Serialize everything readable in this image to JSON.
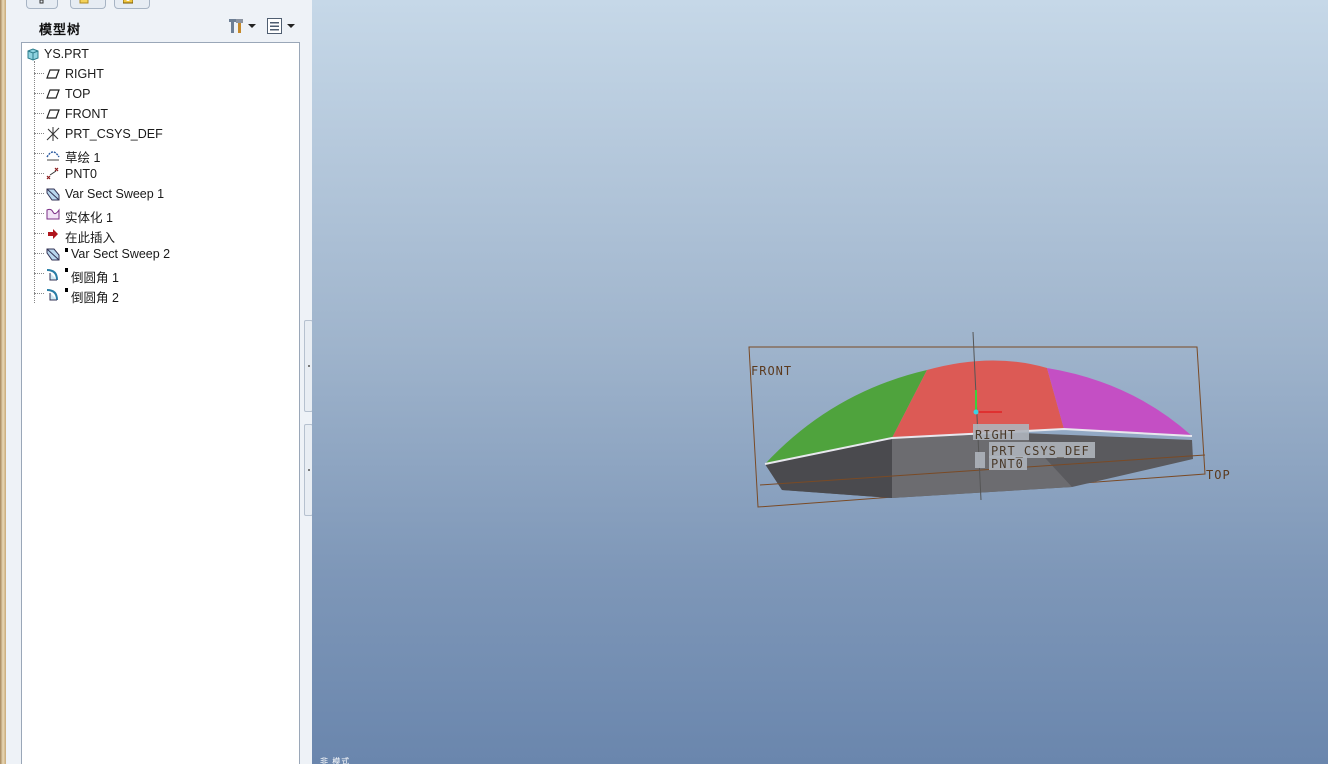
{
  "tree_panel": {
    "title": "模型树",
    "root": "YS.PRT",
    "items": [
      {
        "label": "RIGHT",
        "icon": "datum-plane-icon"
      },
      {
        "label": "TOP",
        "icon": "datum-plane-icon"
      },
      {
        "label": "FRONT",
        "icon": "datum-plane-icon"
      },
      {
        "label": "PRT_CSYS_DEF",
        "icon": "coordinate-system-icon"
      },
      {
        "label": "草绘 1",
        "icon": "sketch-icon"
      },
      {
        "label": "PNT0",
        "icon": "datum-point-icon"
      },
      {
        "label": "Var Sect Sweep 1",
        "icon": "sweep-icon"
      },
      {
        "label": "实体化 1",
        "icon": "solidify-icon"
      },
      {
        "label": "在此插入",
        "icon": "insert-here-arrow-icon"
      },
      {
        "label": "Var Sect Sweep 2",
        "icon": "sweep-icon"
      },
      {
        "label": "倒圆角 1",
        "icon": "round-icon"
      },
      {
        "label": "倒圆角 2",
        "icon": "round-icon"
      }
    ]
  },
  "viewport": {
    "datum_labels": {
      "front": "FRONT",
      "right": "RIGHT",
      "top": "TOP",
      "csys": "PRT_CSYS_DEF",
      "point": "PNT0"
    },
    "mode_text": "非  模式",
    "colors": {
      "bg_top": "#c6d8e8",
      "bg_bottom": "#6a86ad",
      "datum": "#7a4a25",
      "surface_green": "#4fa33d",
      "surface_red": "#dc5a55",
      "surface_magenta": "#c44fc4",
      "body_gray": "#5e5e62"
    }
  }
}
